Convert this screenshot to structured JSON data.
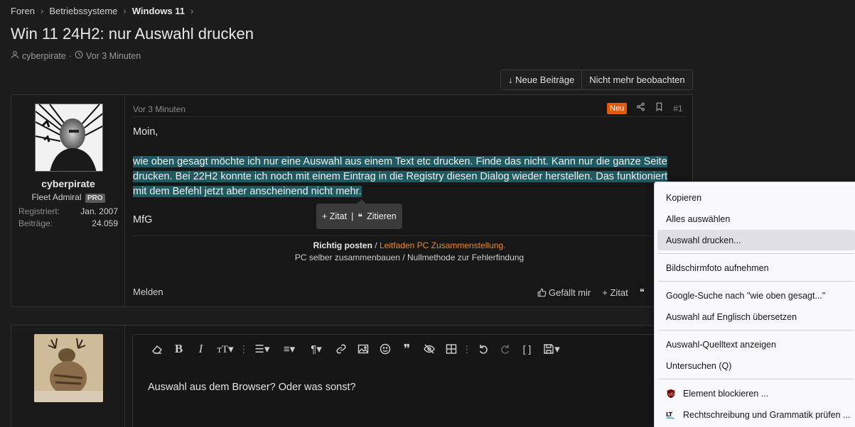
{
  "breadcrumb": [
    {
      "label": "Foren"
    },
    {
      "label": "Betriebssysteme"
    },
    {
      "label": "Windows 11"
    }
  ],
  "thread": {
    "title": "Win 11 24H2: nur Auswahl drucken",
    "author": "cyberpirate",
    "time": "Vor 3 Minuten"
  },
  "buttons": {
    "new_posts": "↓ Neue Beiträge",
    "unwatch": "Nicht mehr beobachten"
  },
  "post1": {
    "username": "cyberpirate",
    "user_title": "Fleet Admiral",
    "pro_badge": "PRO",
    "stats": [
      {
        "label": "Registriert:",
        "value": "Jan. 2007"
      },
      {
        "label": "Beiträge:",
        "value": "24.059"
      }
    ],
    "time": "Vor 3 Minuten",
    "new_badge": "Neu",
    "number": "#1",
    "greeting": "Moin,",
    "lines": [
      "wie oben gesagt möchte ich nur eine Auswahl aus einem Text etc drucken. Finde das nicht. Kann nur die ganze Seite",
      "drucken. Bei 22H2 konnte ich noch mit einem Eintrag in die Registry diesen Dialog wieder herstellen. Das funktioniert",
      "mit dem Befehl jetzt aber anscheinend nicht mehr."
    ],
    "closing": "MfG",
    "quote_popup": {
      "zitat": "+ Zitat",
      "divider": "|",
      "zitieren": "Zitieren"
    },
    "signature": {
      "line1_bold": "Richtig posten",
      "line1_sep": " / ",
      "line1_link": "Leitfaden PC Zusammenstellung.",
      "line2_a": "PC selber zusammenbauen",
      "line2_sep": " / ",
      "line2_b": "Nullmethode zur Fehlerfindung"
    },
    "report": "Melden",
    "like": "Gefällt mir",
    "quote": "+ Zitat"
  },
  "post2": {
    "editor_text": "Auswahl aus dem Browser? Oder was sonst?"
  },
  "context_menu": {
    "items": [
      {
        "label": "Kopieren",
        "highlight": false
      },
      {
        "label": "Alles auswählen",
        "highlight": false
      },
      {
        "label": "Auswahl drucken...",
        "highlight": true
      },
      {
        "label": "Bildschirmfoto aufnehmen",
        "highlight": false
      },
      {
        "label": "Google-Suche nach \"wie oben gesagt...\"",
        "highlight": false
      },
      {
        "label": "Auswahl auf Englisch übersetzen",
        "highlight": false
      },
      {
        "label": "Auswahl-Quelltext anzeigen",
        "highlight": false
      },
      {
        "label": "Untersuchen (Q)",
        "highlight": false
      },
      {
        "label": "Element blockieren ...",
        "highlight": false,
        "icon": "ublock-icon"
      },
      {
        "label": "Rechtschreibung und Grammatik prüfen ...",
        "highlight": false,
        "icon": "languagetool-icon"
      }
    ]
  },
  "colors": {
    "selection": "#1f5a63",
    "accent_orange": "#e8892c",
    "new_badge": "#e05a0c"
  }
}
